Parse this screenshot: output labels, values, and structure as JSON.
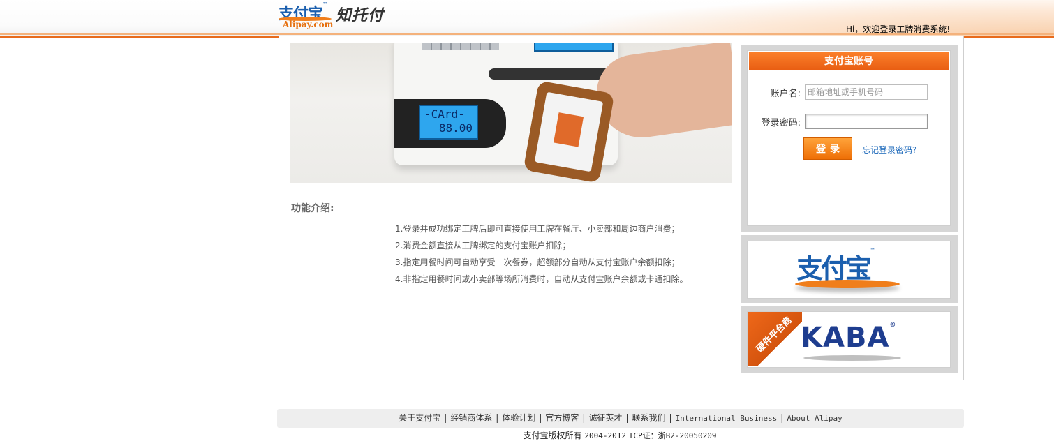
{
  "header": {
    "logo_cn": "支付宝",
    "logo_en": "Alipay.com",
    "logo_sub": "知托付",
    "welcome": "Hi，欢迎登录工牌消费系统!"
  },
  "hero": {
    "lcd_line1": "-CArd-",
    "lcd_line2": "88.00"
  },
  "features": {
    "title": "功能介绍:",
    "items": [
      "1.登录并成功绑定工牌后即可直接使用工牌在餐厅、小卖部和周边商户消费；",
      "2.消费金额直接从工牌绑定的支付宝账户扣除；",
      "3.指定用餐时间可自动享受一次餐券，超额部分自动从支付宝账户余额扣除；",
      "4.非指定用餐时间或小卖部等场所消费时，自动从支付宝账户余额或卡通扣除。"
    ]
  },
  "login": {
    "title": "支付宝账号",
    "account_label": "账户名:",
    "account_placeholder": "邮箱地址或手机号码",
    "password_label": "登录密码:",
    "password_value": "",
    "submit_label": "登录",
    "forgot_label": "忘记登录密码?"
  },
  "brands": {
    "alipay_logo": "支付宝",
    "kaba_logo": "KABA",
    "hardware_ribbon": "硬件平台商"
  },
  "footer": {
    "links": [
      "关于支付宝",
      "经销商体系",
      "体验计划",
      "官方博客",
      "诚征英才",
      "联系我们",
      "International Business",
      "About Alipay"
    ],
    "copyright_cn": "支付宝版权所有",
    "copyright_years": "2004-2012",
    "icp": "ICP证：浙B2-20050209"
  },
  "colors": {
    "accent_orange": "#e86b1c",
    "link_blue": "#1664b8",
    "brand_blue": "#1b5fae"
  }
}
